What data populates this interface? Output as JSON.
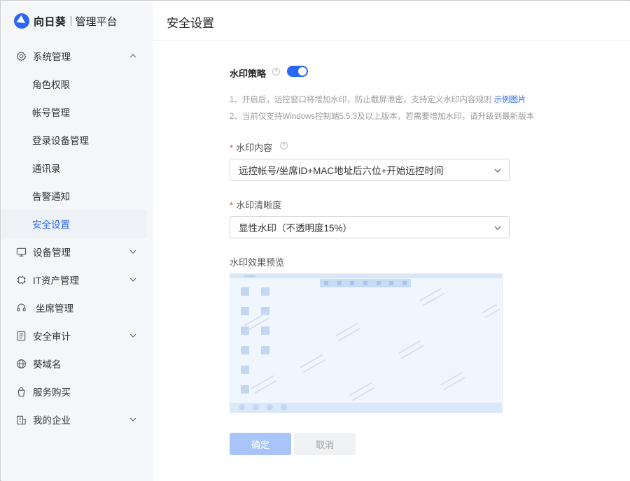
{
  "app": {
    "brand": "向日葵",
    "subtitle": "管理平台"
  },
  "sidebar": {
    "items": [
      {
        "label": "系统管理",
        "icon": "gear-icon",
        "expanded": true
      },
      {
        "label": "设备管理",
        "icon": "monitor-icon",
        "expanded": false
      },
      {
        "label": "IT资产管理",
        "icon": "chip-icon",
        "expanded": false
      },
      {
        "label": "坐席管理",
        "icon": "headset-icon"
      },
      {
        "label": "安全审计",
        "icon": "document-icon",
        "expanded": false
      },
      {
        "label": "葵域名",
        "icon": "globe-icon"
      },
      {
        "label": "服务购买",
        "icon": "shopping-bag-icon"
      },
      {
        "label": "我的企业",
        "icon": "building-icon",
        "expanded": false
      }
    ],
    "sub_items": [
      {
        "label": "角色权限"
      },
      {
        "label": "帐号管理"
      },
      {
        "label": "登录设备管理"
      },
      {
        "label": "通讯录"
      },
      {
        "label": "告警通知"
      },
      {
        "label": "安全设置",
        "active": true
      }
    ]
  },
  "header": {
    "title": "安全设置"
  },
  "main": {
    "watermark_policy_label": "水印策略",
    "watermark_enabled": true,
    "note_1": "1、开启后，远控窗口将增加水印，防止截屏泄密，支持定义水印内容规则",
    "note_1_link": "示例图片",
    "note_2": "2、当前仅支持Windows控制端5.5.3及以上版本，若需要增加水印，请升级到最新版本",
    "content_label": "水印内容",
    "content_value": "远控帐号/坐席ID+MAC地址后六位+开始远控时间",
    "clarity_label": "水印清晰度",
    "clarity_value": "显性水印（不透明度15%）",
    "required_mark": "*",
    "help_glyph": "?",
    "preview_label": "水印效果预览",
    "ok_label": "确定",
    "cancel_label": "取消"
  },
  "colors": {
    "accent": "#2a67f4",
    "required": "#e64a3b",
    "ok_disabled": "#a8c4f9"
  }
}
